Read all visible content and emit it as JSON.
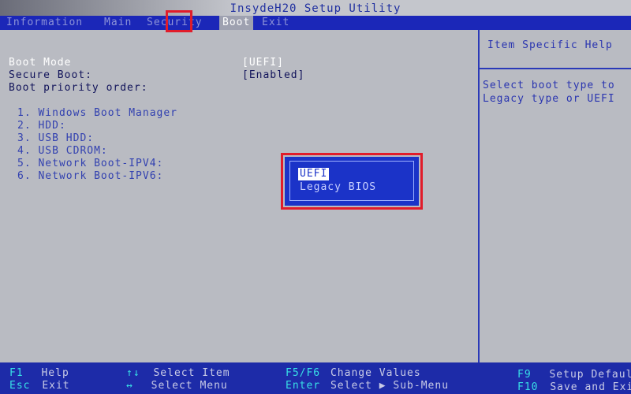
{
  "title": "InsydeH20 Setup Utility",
  "menu": [
    {
      "label": "Information"
    },
    {
      "label": "Main"
    },
    {
      "label": "Security"
    },
    {
      "label": "Boot"
    },
    {
      "label": "Exit"
    }
  ],
  "active_menu": "Boot",
  "settings": [
    {
      "label": "Boot Mode",
      "value": "[UEFI]"
    },
    {
      "label": "Secure Boot:",
      "value": "[Enabled]"
    }
  ],
  "boot_order_title": "Boot priority order:",
  "boot_order": [
    "1. Windows Boot Manager",
    "2. HDD:",
    "3. USB HDD:",
    "4. USB CDROM:",
    "5. Network Boot-IPV4:",
    "6. Network Boot-IPV6:"
  ],
  "help_panel": {
    "header": "Item Specific Help",
    "lines": [
      "Select boot type to",
      "Legacy type or UEFI"
    ]
  },
  "popup": {
    "options": [
      "UEFI",
      "Legacy BIOS"
    ],
    "selected": "UEFI"
  },
  "footer": [
    {
      "key": "F1",
      "desc": "Help"
    },
    {
      "key": "Esc",
      "desc": "Exit"
    },
    {
      "key": "↑↓",
      "desc": "Select Item"
    },
    {
      "key": "↔",
      "desc": "Select Menu"
    },
    {
      "key": "F5/F6",
      "desc": "Change Values"
    },
    {
      "key": "Enter",
      "desc": "Select ▶ Sub-Menu"
    },
    {
      "key": "F9",
      "desc": "Setup Defaults"
    },
    {
      "key": "F10",
      "desc": "Save and Exit"
    }
  ],
  "colors": {
    "screen_bg": "#b9bbc2",
    "menu_bar": "#1b27b8",
    "popup_bg": "#1b33c8",
    "highlight_box": "#e11c2a",
    "footer_bg": "#1d2ba8",
    "footer_key": "#38e0e6"
  }
}
